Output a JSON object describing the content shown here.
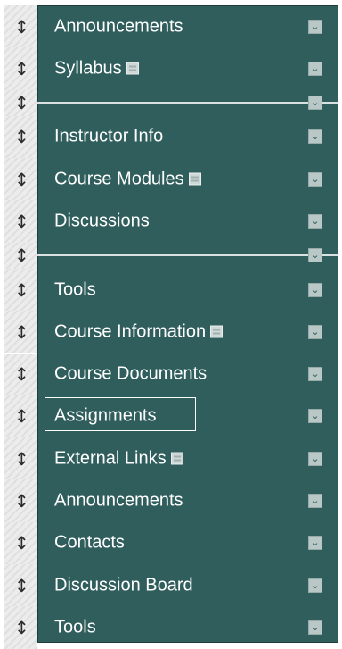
{
  "menu": {
    "items": [
      {
        "type": "link",
        "label": "Announcements",
        "external": false,
        "selected": false
      },
      {
        "type": "link",
        "label": "Syllabus",
        "external": true,
        "selected": false
      },
      {
        "type": "divider"
      },
      {
        "type": "link",
        "label": "Instructor Info",
        "external": false,
        "selected": false
      },
      {
        "type": "link",
        "label": "Course Modules",
        "external": true,
        "selected": false
      },
      {
        "type": "link",
        "label": "Discussions",
        "external": false,
        "selected": false
      },
      {
        "type": "divider"
      },
      {
        "type": "link",
        "label": "Tools",
        "external": false,
        "selected": false
      },
      {
        "type": "link",
        "label": "Course Information",
        "external": true,
        "selected": false
      },
      {
        "type": "link",
        "label": "Course Documents",
        "external": false,
        "selected": false
      },
      {
        "type": "link",
        "label": "Assignments",
        "external": false,
        "selected": true
      },
      {
        "type": "link",
        "label": "External Links",
        "external": true,
        "selected": false
      },
      {
        "type": "link",
        "label": "Announcements",
        "external": false,
        "selected": false
      },
      {
        "type": "link",
        "label": "Contacts",
        "external": false,
        "selected": false
      },
      {
        "type": "link",
        "label": "Discussion Board",
        "external": false,
        "selected": false
      },
      {
        "type": "link",
        "label": "Tools",
        "external": false,
        "selected": false
      }
    ]
  },
  "icons": {
    "drag_handle": "drag-handle-icon",
    "hide_toggle": "chevron-down-icon",
    "external_link": "external-link-icon"
  },
  "colors": {
    "panel_background": "#2f5e5c",
    "text": "#ffffff",
    "divider": "#d9e2e0",
    "handle_background": "#ececec"
  }
}
